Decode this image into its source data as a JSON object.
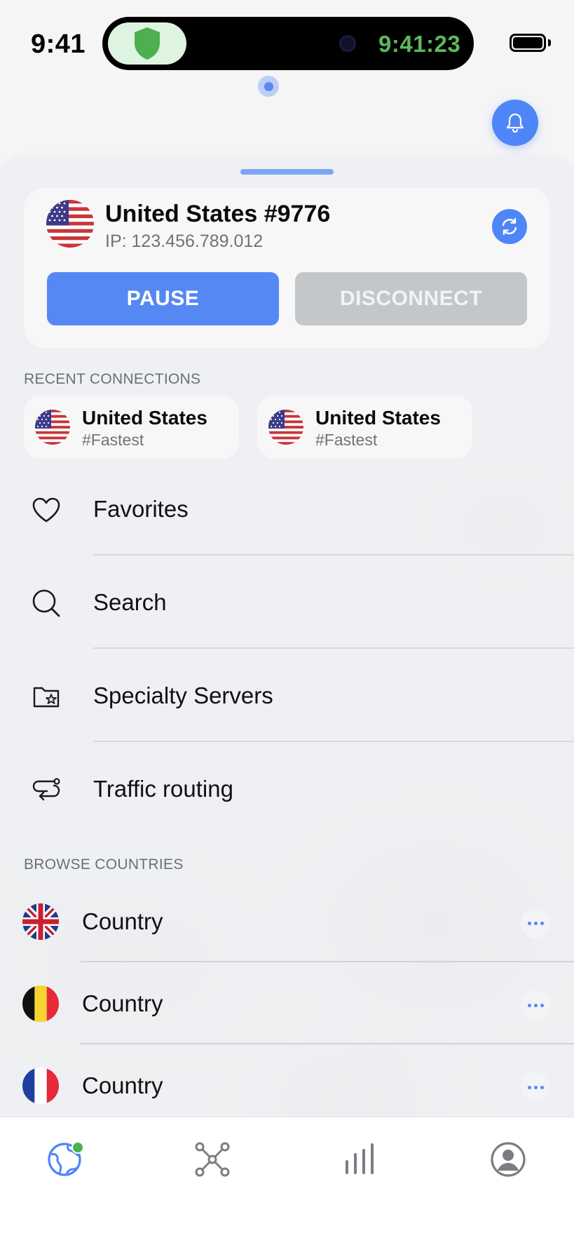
{
  "status_bar": {
    "time": "9:41",
    "island_timer": "9:41:23",
    "icons": [
      "shield-icon",
      "battery-icon"
    ]
  },
  "colors": {
    "accent": "#4f86f7",
    "pause_button": "#5588f3",
    "disconnect_button": "#c4c7ca",
    "connected_green": "#5cb85c",
    "shield_green": "#4caf50"
  },
  "connection": {
    "server_name": "United States #9776",
    "ip": "IP: 123.456.789.012",
    "flag": "us-flag",
    "pause_label": "PAUSE",
    "disconnect_label": "DISCONNECT"
  },
  "recent": {
    "section_label": "RECENT CONNECTIONS",
    "items": [
      {
        "title": "United States",
        "subtitle": "#Fastest",
        "flag": "us-flag"
      },
      {
        "title": "United States",
        "subtitle": "#Fastest",
        "flag": "us-flag"
      }
    ]
  },
  "menu": [
    {
      "label": "Favorites",
      "icon": "heart-icon"
    },
    {
      "label": "Search",
      "icon": "search-icon"
    },
    {
      "label": "Specialty Servers",
      "icon": "folder-star-icon"
    },
    {
      "label": "Traffic routing",
      "icon": "route-icon"
    }
  ],
  "browse": {
    "section_label": "BROWSE COUNTRIES",
    "countries": [
      {
        "label": "Country",
        "flag": "uk-flag"
      },
      {
        "label": "Country",
        "flag": "belgium-flag"
      },
      {
        "label": "Country",
        "flag": "france-flag"
      }
    ]
  },
  "tabs": [
    {
      "name": "globe-tab",
      "icon": "globe-icon",
      "active": true
    },
    {
      "name": "network-tab",
      "icon": "network-icon",
      "active": false
    },
    {
      "name": "stats-tab",
      "icon": "bar-chart-icon",
      "active": false
    },
    {
      "name": "profile-tab",
      "icon": "profile-icon",
      "active": false
    }
  ]
}
